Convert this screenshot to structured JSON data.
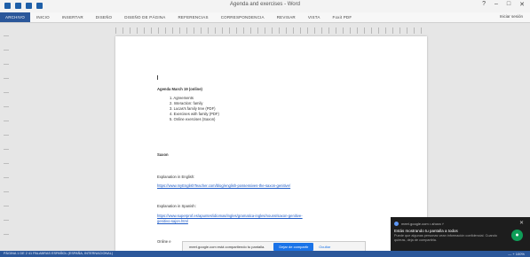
{
  "window": {
    "title": "Agenda and exercises - Word",
    "controls": [
      "?",
      "–",
      "□",
      "✕"
    ]
  },
  "ribbon": {
    "tabs": [
      "ARCHIVO",
      "INICIO",
      "INSERTAR",
      "DISEÑO",
      "DISEÑO DE PÁGINA",
      "REFERENCIAS",
      "CORRESPONDENCIA",
      "REVISAR",
      "VISTA",
      "Foxit PDF"
    ],
    "user": "Iniciar sesión"
  },
  "document": {
    "heading": "Agenda March 19 (online)",
    "agenda_items": [
      "1.  Agreements",
      "2.  Interaction: family",
      "3.  Lucas's family tree (PDF)",
      "4.  Exercises with family (PDF)",
      "5.  Online exercises (Saxon)"
    ],
    "section_label": "Saxon",
    "explanation_english_label": "Explanation in English:",
    "explanation_english_link": "https://www.myEnglishTeacher.com/blog/english-possessives-the-saxon-genitive/",
    "explanation_spanish_label": "Explanation in Spanish:",
    "explanation_spanish_link_1": "https://www.superprof.es/apuntes/idiomas/ingles/gramatica-ingles/nouns/saxon-genitive-",
    "explanation_spanish_link_2": "genitivo-sajon.html",
    "partial_line": "Online e"
  },
  "statusbar": {
    "left": "PÁGINA 1 DE 2   41 PALABRAS   ESPAÑOL (ESPAÑA, INTERNACIONAL)",
    "right": "—  +  100%"
  },
  "chrome_share_bar": {
    "message": "meet.google.com está compartiendo tu pantalla.",
    "stop_label": "Dejar de compartir",
    "hide_label": "Ocultar"
  },
  "notification": {
    "app": "meet.google.com  •  ahora  ˅",
    "close": "✕",
    "title": "Estás mostrando tu pantalla a todos",
    "body": "Puede que algunas personas vean información confidencial. Cuando quieras, deja de compartirla.",
    "icon": "meet-icon",
    "accent_color": "#0f9d58"
  },
  "colors": {
    "ribbon_accent": "#2b579a",
    "link": "#1f5bc6"
  }
}
